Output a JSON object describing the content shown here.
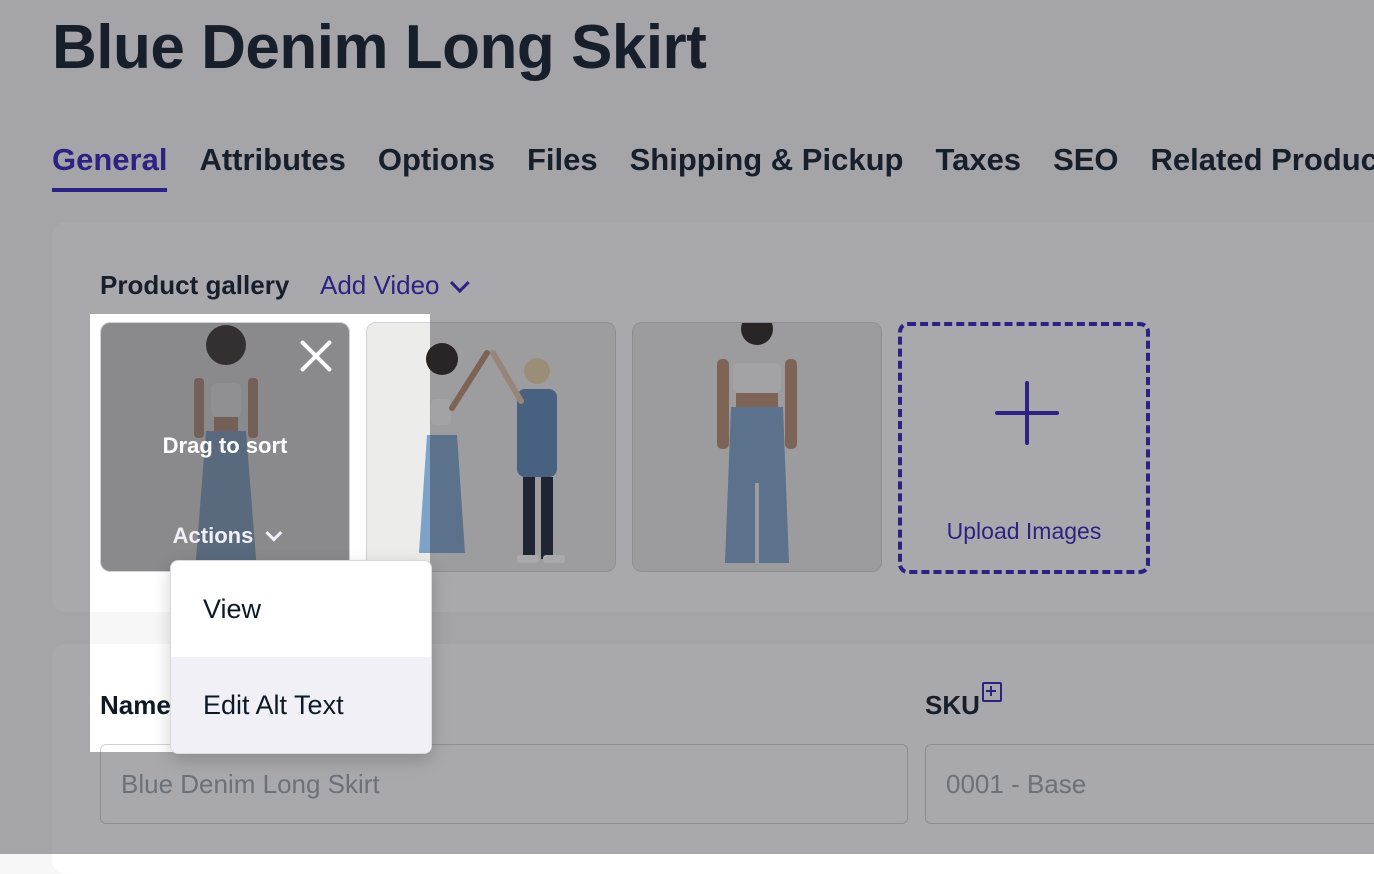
{
  "page": {
    "title": "Blue Denim Long Skirt"
  },
  "tabs": [
    {
      "label": "General",
      "active": true
    },
    {
      "label": "Attributes"
    },
    {
      "label": "Options"
    },
    {
      "label": "Files"
    },
    {
      "label": "Shipping & Pickup"
    },
    {
      "label": "Taxes"
    },
    {
      "label": "SEO"
    },
    {
      "label": "Related Products"
    }
  ],
  "gallery": {
    "label": "Product gallery",
    "add_video_label": "Add Video",
    "thumbnail_hover": {
      "drag_label": "Drag to sort",
      "actions_label": "Actions"
    },
    "upload_label": "Upload Images"
  },
  "actions_menu": {
    "items": [
      "View",
      "Edit Alt Text"
    ],
    "highlighted": "Edit Alt Text"
  },
  "fields": {
    "name_label": "Name",
    "name_placeholder": "Blue Denim Long Skirt",
    "sku_label": "SKU",
    "sku_placeholder": "0001 - Base"
  },
  "colors": {
    "accent": "#2e1fb8",
    "text": "#0d1a26",
    "placeholder": "#9aa0a8",
    "page_background": "#f7f7f8",
    "card_background": "#ffffff",
    "overlay": "#3c3c41"
  }
}
